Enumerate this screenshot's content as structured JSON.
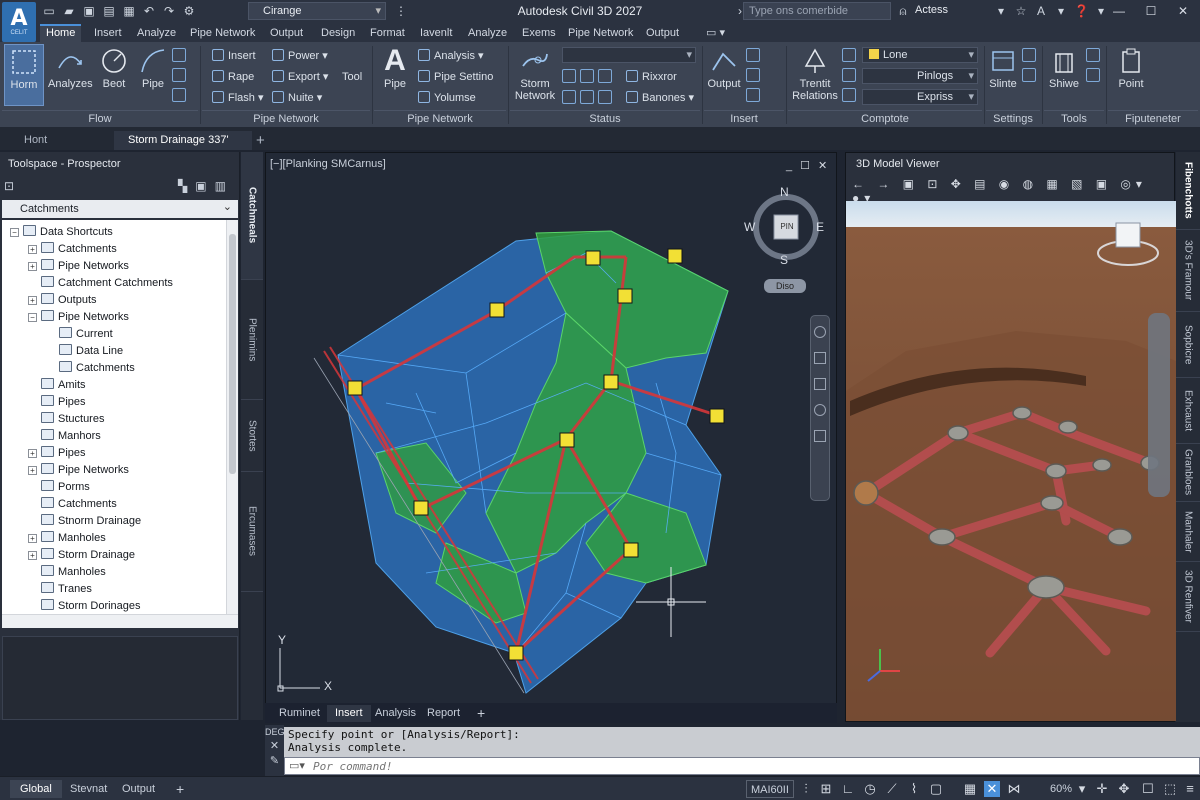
{
  "app": {
    "logo_letter": "A",
    "logo_sub": "CELIT",
    "title": "Autodesk Civil 3D 2027",
    "workspace": "Cirange",
    "search_placeholder": "Type ons comerbide",
    "signin_label": "Actess",
    "qat_icons": [
      "new-icon",
      "open-icon",
      "save-icon",
      "save-as-icon",
      "print-icon",
      "undo-icon",
      "redo-icon",
      "workspace-gear-icon"
    ]
  },
  "ribbon_tabs": [
    "Home",
    "Insert",
    "Analyze",
    "Pipe Network",
    "Output",
    "Design",
    "Format",
    "Iavenlt",
    "Analyze",
    "Exems",
    "Pipe Network",
    "Output"
  ],
  "ribbon": {
    "flow": {
      "title": "Flow",
      "buttons": [
        "Horm",
        "Analyzes",
        "Beot",
        "Pipe"
      ]
    },
    "pipe_network_1": {
      "title": "Pipe Network",
      "items": [
        "Insert",
        "Rape",
        "Flash",
        "Power",
        "Export",
        "Nuite",
        "Tool"
      ]
    },
    "pipe_network_2": {
      "title": "Pipe Network",
      "big_button": "Pipe",
      "items": [
        "Analysis",
        "Pipe Settino",
        "Yolumse"
      ]
    },
    "status": {
      "title": "Status",
      "big_button": "Storm Network",
      "items": [
        "Rixxror",
        "Banones"
      ]
    },
    "insert": {
      "title": "Insert",
      "big_button": "Output"
    },
    "comptote": {
      "title": "Comptote",
      "big_button": "Trentit Relations",
      "combos": [
        "Lone",
        "Pinlogs",
        "Expriss"
      ]
    },
    "settings": {
      "title": "Settings",
      "big_button": "Slinte"
    },
    "tools": {
      "title": "Tools",
      "big_button": "Shiwe"
    },
    "fiputeneter": {
      "title": "Fiputeneter",
      "big_button": "Point"
    }
  },
  "doc_tabs": [
    "Hont",
    "Storm Drainage 337'"
  ],
  "prospector": {
    "title": "Toolspace - Prospector",
    "combo_value": "Catchments",
    "tree": [
      {
        "label": "Data Shortcuts",
        "level": 0,
        "toggle": "−"
      },
      {
        "label": "Catchments",
        "level": 1,
        "toggle": "+"
      },
      {
        "label": "Pipe Networks",
        "level": 1,
        "toggle": "+"
      },
      {
        "label": "Catchment Catchments",
        "level": 1,
        "toggle": ""
      },
      {
        "label": "Outputs",
        "level": 1,
        "toggle": "+"
      },
      {
        "label": "Pipe Networks",
        "level": 1,
        "toggle": "−"
      },
      {
        "label": "Current",
        "level": 2,
        "toggle": ""
      },
      {
        "label": "Data Line",
        "level": 2,
        "toggle": ""
      },
      {
        "label": "Catchments",
        "level": 2,
        "toggle": ""
      },
      {
        "label": "Amits",
        "level": 1,
        "toggle": ""
      },
      {
        "label": "Pipes",
        "level": 1,
        "toggle": ""
      },
      {
        "label": "Stuctures",
        "level": 1,
        "toggle": ""
      },
      {
        "label": "Manhors",
        "level": 1,
        "toggle": ""
      },
      {
        "label": "Pipes",
        "level": 1,
        "toggle": "+"
      },
      {
        "label": "Pipe Networks",
        "level": 1,
        "toggle": "+"
      },
      {
        "label": "Porms",
        "level": 1,
        "toggle": ""
      },
      {
        "label": "Catchments",
        "level": 1,
        "toggle": ""
      },
      {
        "label": "Stnorm Drainage",
        "level": 1,
        "toggle": ""
      },
      {
        "label": "Manholes",
        "level": 1,
        "toggle": "+"
      },
      {
        "label": "Storm Drainage",
        "level": 1,
        "toggle": "+"
      },
      {
        "label": "Manholes",
        "level": 1,
        "toggle": ""
      },
      {
        "label": "Tranes",
        "level": 1,
        "toggle": ""
      },
      {
        "label": "Storm Dorinages",
        "level": 1,
        "toggle": ""
      }
    ]
  },
  "side_tabs": [
    "Catchmeals",
    "Plenimins",
    "Stortes",
    "Ercumases"
  ],
  "viewport": {
    "label": "[−][Planking SMCarnus]",
    "compass": {
      "n": "N",
      "s": "S",
      "e": "E",
      "w": "W",
      "center": "PIN"
    },
    "view_label": "Diso",
    "axis_x": "X",
    "axis_y": "Y",
    "tabs": [
      "Ruminet",
      "Insert",
      "Analysis",
      "Report"
    ]
  },
  "viewer": {
    "title": "3D Model Viewer"
  },
  "right_tabs": [
    "Fibenchotts",
    "3D's Framour",
    "Sopbicre",
    "Exhcaust",
    "Granbloes",
    "Manhaler",
    "3D Renfiver"
  ],
  "command": {
    "side_label": "DEGI",
    "history": [
      "Specify point or [Analysis/Report]:",
      "Analysis complete."
    ],
    "placeholder": "Por command!"
  },
  "statusbar": {
    "tabs": [
      "Global",
      "Stevnat",
      "Output"
    ],
    "model_label": "MAI60II",
    "zoom": "60%"
  },
  "colors": {
    "catchment_blue": "#2c6fb8",
    "catchment_green": "#2f9e3f",
    "pipe_red": "#d6363a",
    "structure_yellow": "#f2e035"
  }
}
